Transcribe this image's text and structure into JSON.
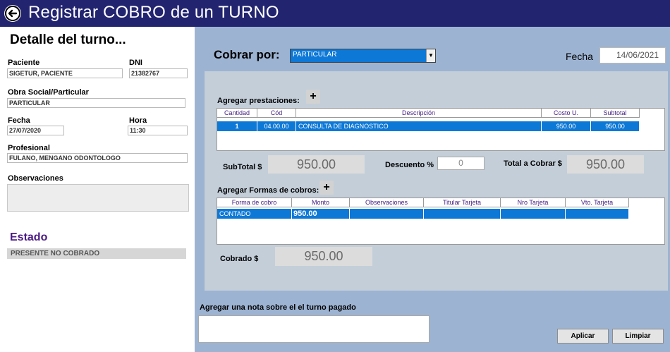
{
  "window": {
    "title": "Registrar COBRO  de un TURNO"
  },
  "detail": {
    "title": "Detalle del turno...",
    "paciente_label": "Paciente",
    "paciente_value": "SIGETUR, PACIENTE",
    "dni_label": "DNI",
    "dni_value": "21382767",
    "obra_label": "Obra Social/Particular",
    "obra_value": "PARTICULAR",
    "fecha_label": "Fecha",
    "fecha_value": "27/07/2020",
    "hora_label": "Hora",
    "hora_value": "11:30",
    "profesional_label": "Profesional",
    "profesional_value": "FULANO, MENGANO ODONTOLOGO",
    "observaciones_label": "Observaciones",
    "observaciones_value": ""
  },
  "estado": {
    "title": "Estado",
    "value": "PRESENTE NO COBRADO"
  },
  "cobro": {
    "cobrar_por_label": "Cobrar por:",
    "cobrar_por_value": "PARTICULAR",
    "fecha_label": "Fecha",
    "fecha_value": "14/06/2021"
  },
  "prestaciones": {
    "label": "Agregar prestaciones:",
    "add_icon": "plus-icon",
    "columns": [
      "Cantidad",
      "Cód",
      "Descripción",
      "Costo U.",
      "Subtotal"
    ],
    "rows": [
      {
        "cantidad": "1",
        "cod": "04.00.00",
        "descripcion": "CONSULTA DE DIAGNOSTICO",
        "costo": "950.00",
        "subtotal": "950.00"
      }
    ]
  },
  "totals": {
    "subtotal_label": "SubTotal $",
    "subtotal_value": "950.00",
    "descuento_label": "Descuento %",
    "descuento_value": "0",
    "total_label": "Total a Cobrar $",
    "total_value": "950.00"
  },
  "formas": {
    "label": "Agregar Formas de cobros:",
    "add_icon": "plus-icon",
    "columns": [
      "Forma de cobro",
      "Monto",
      "Observaciones",
      "Titular Tarjeta",
      "Nro Tarjeta",
      "Vto. Tarjeta"
    ],
    "rows": [
      {
        "forma": "CONTADO",
        "monto": "950.00",
        "observaciones": "",
        "titular": "",
        "nro": "",
        "vto": ""
      }
    ]
  },
  "cobrado": {
    "label": "Cobrado $",
    "value": "950.00"
  },
  "nota": {
    "label": "Agregar una nota sobre el  el turno pagado",
    "value": ""
  },
  "buttons": {
    "aplicar": "Aplicar",
    "limpiar": "Limpiar"
  },
  "colors": {
    "titlebar": "#222470",
    "selection": "#0d78d6",
    "background": "#9db3d2",
    "panel": "#c3ced9",
    "estado": "#4b1b84"
  }
}
